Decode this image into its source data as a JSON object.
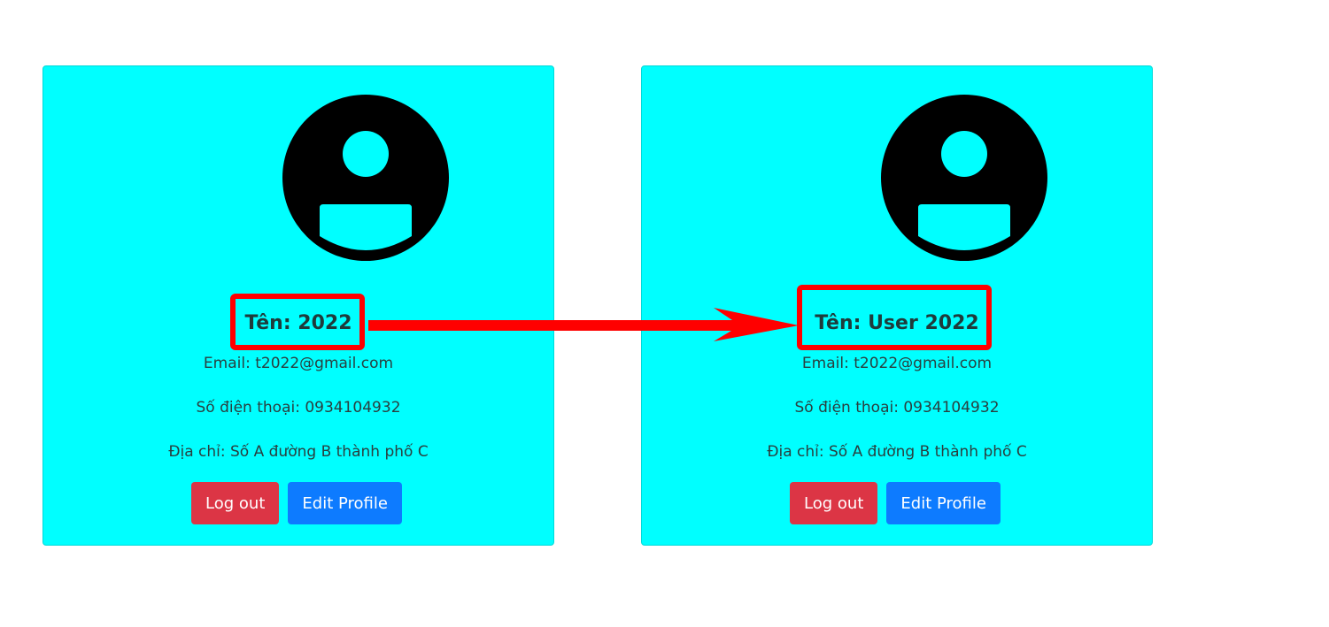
{
  "colors": {
    "card_bg": "#00ffff",
    "highlight": "#ff0000",
    "logout_bg": "#dc3545",
    "edit_bg": "#0d7bff"
  },
  "before": {
    "name": "Tên: 2022",
    "email": "Email: t2022@gmail.com",
    "phone": "Số điện thoại: 0934104932",
    "address": "Địa chỉ: Số A đường B thành phố C",
    "logout_label": "Log out",
    "edit_label": "Edit Profile",
    "avatar_icon": "user-circle-icon"
  },
  "after": {
    "name": "Tên: User 2022",
    "email": "Email: t2022@gmail.com",
    "phone": "Số điện thoại: 0934104932",
    "address": "Địa chỉ: Số A đường B thành phố C",
    "logout_label": "Log out",
    "edit_label": "Edit Profile",
    "avatar_icon": "user-circle-icon"
  },
  "annotation": {
    "arrow_icon": "arrow-right-icon"
  }
}
